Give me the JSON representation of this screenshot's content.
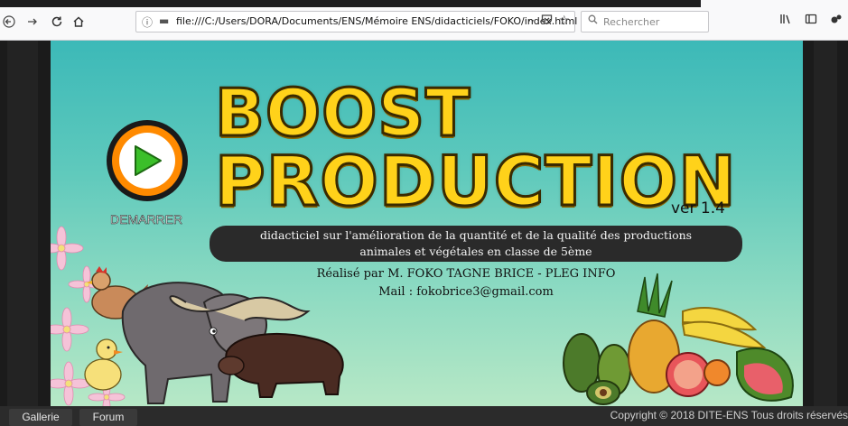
{
  "browser": {
    "url": "file:///C:/Users/DORA/Documents/ENS/Mémoire ENS/didacticiels/FOKO/index.html",
    "more_label": "···",
    "search_placeholder": "Rechercher",
    "icons": [
      "back-icon",
      "forward-icon",
      "reload-icon",
      "home-icon",
      "info-icon",
      "page-icon",
      "more-icon",
      "pocket-icon",
      "star-icon",
      "search-icon",
      "library-icon",
      "sidebar-icon",
      "extension-icon",
      "menu-icon"
    ]
  },
  "app": {
    "title_line1": "BOOST",
    "title_line2": "PRODUCTION",
    "version": "ver 1.4",
    "start_label": "DEMARRER",
    "description_line1": "didacticiel sur l'amélioration de la quantité et de la qualité des productions",
    "description_line2": "animales et végétales en classe de 5ème",
    "author": "Réalisé par M. FOKO TAGNE BRICE - PLEG INFO",
    "mail": "Mail : fokobrice3@gmail.com",
    "colors": {
      "title": "#ffd21a",
      "play_ring": "#ff8a00",
      "play_arrow": "#3bbf2a",
      "background_top": "#3cb9b8",
      "background_bottom": "#b7e8c6"
    }
  },
  "footer": {
    "buttons": [
      "Gallerie",
      "Forum"
    ],
    "copyright": "Copyright © 2018 DITE-ENS Tous droits réservés"
  }
}
